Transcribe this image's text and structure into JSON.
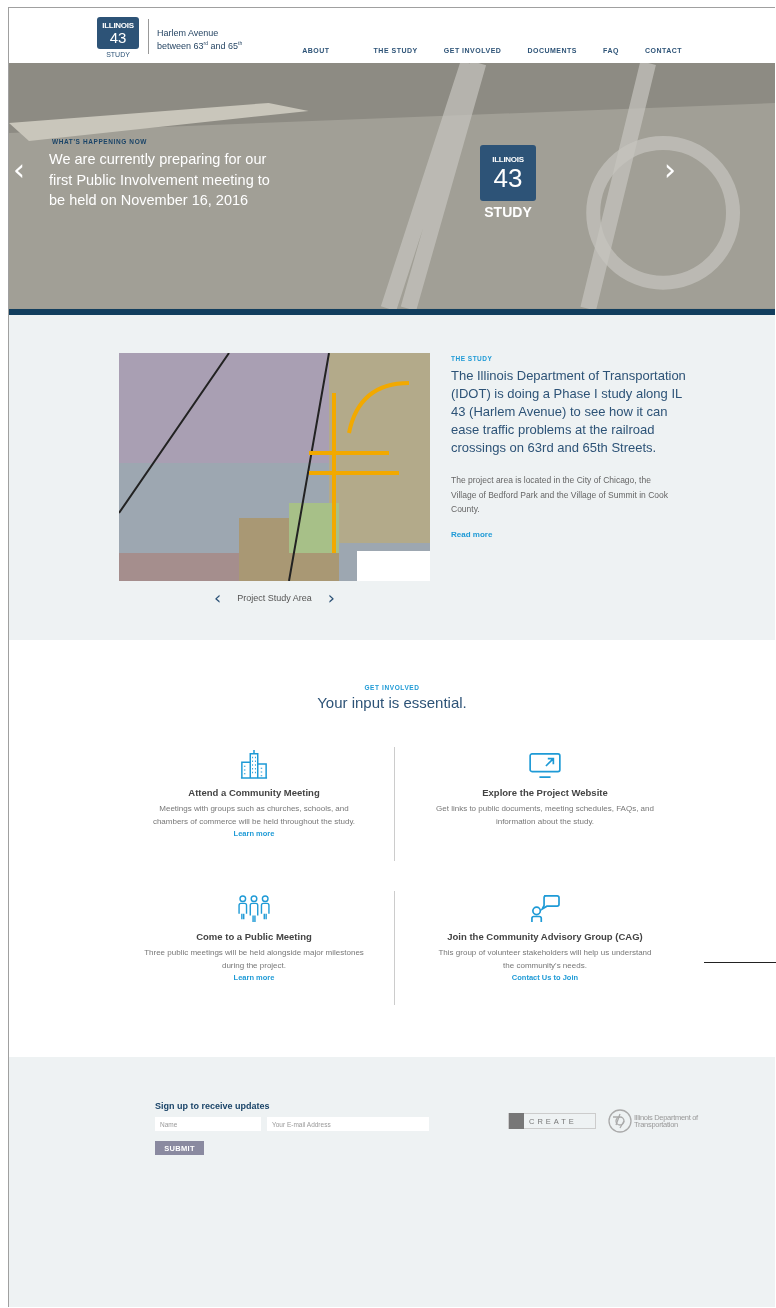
{
  "header": {
    "logo": {
      "top": "ILLINOIS",
      "number": "43",
      "bottom": "STUDY"
    },
    "tagline": [
      "Harlem Avenue",
      "between 63$^{rd}$ and 65$^{th}$"
    ],
    "nav": [
      {
        "label": "ABOUT"
      },
      {
        "label": "THE STUDY"
      },
      {
        "label": "GET INVOLVED"
      },
      {
        "label": "DOCUMENTS"
      },
      {
        "label": "FAQ"
      },
      {
        "label": "CONTACT"
      }
    ]
  },
  "hero": {
    "eyebrow": "WHAT'S HAPPENING NOW",
    "message": "We are currently preparing for our first Public Involvement meeting to be held on November 16, 2016",
    "prev": "‹",
    "next": "›",
    "logo": {
      "top": "ILLINOIS",
      "number": "43",
      "bottom": "STUDY"
    }
  },
  "study": {
    "caption": "Project Study Area",
    "prev": "‹",
    "next": "›",
    "eyebrow": "THE STUDY",
    "lead": "The Illinois Department of Transportation (IDOT) is doing a Phase I study along IL 43 (Harlem Avenue) to see how it can ease traffic problems at the railroad crossings on 63rd and 65th Streets.",
    "body": "The project area is located in the City of Chicago, the Village of Bedford Park and the Village of Summit in Cook County.",
    "link": "Read more"
  },
  "involved": {
    "eyebrow": "GET INVOLVED",
    "title": "Your input is essential.",
    "items": [
      {
        "title": "Attend a Community Meeting",
        "text": "Meetings with groups such as churches, schools, and chambers of commerce will be held throughout the study.",
        "link": "Learn more"
      },
      {
        "title": "Explore the Project Website",
        "text": "Get links to public documents, meeting schedules, FAQs,  and information about the study."
      },
      {
        "title": "Come to a Public Meeting",
        "text": "Three public meetings will be held alongside major milestones during the project.",
        "link": "Learn more"
      },
      {
        "title": "Join the Community Advisory Group (CAG)",
        "text": "This group of volunteer stakeholders will help us understand the community's needs.",
        "link": "Contact Us to Join"
      }
    ]
  },
  "signup": {
    "title": "Sign up to receive updates",
    "name_placeholder": "Name",
    "email_placeholder": "Your E-mail Address",
    "submit": "SUBMIT",
    "partners": [
      {
        "name": "CREATE"
      },
      {
        "name": "Illinois Department of Transportation"
      }
    ]
  }
}
